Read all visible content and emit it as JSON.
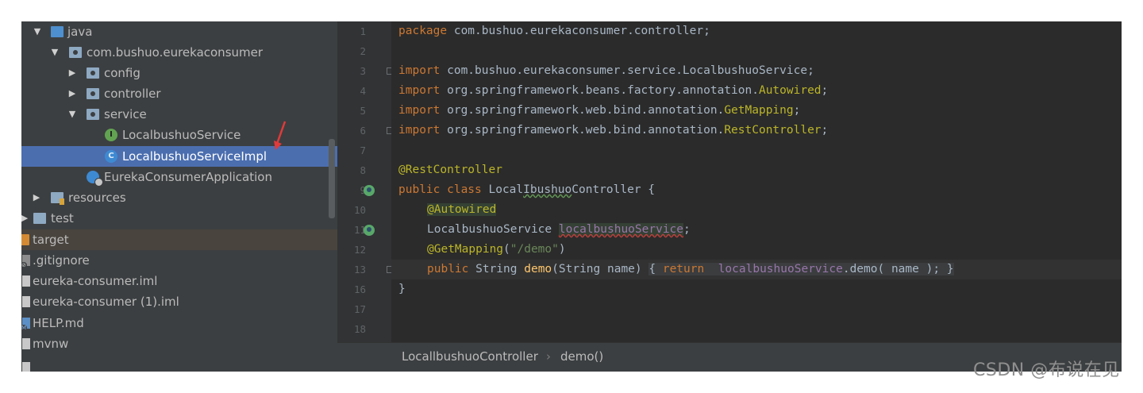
{
  "tree": {
    "items": [
      {
        "label": "java",
        "expanded": true
      },
      {
        "label": "com.bushuo.eurekaconsumer",
        "expanded": true
      },
      {
        "label": "config",
        "expanded": false
      },
      {
        "label": "controller",
        "expanded": false
      },
      {
        "label": "service",
        "expanded": true
      },
      {
        "label": "LocalbushuoService",
        "icon_letter": "I"
      },
      {
        "label": "LocalbushuoServiceImpl",
        "icon_letter": "C",
        "selected": true
      },
      {
        "label": "EurekaConsumerApplication"
      },
      {
        "label": "resources",
        "expanded": false
      },
      {
        "label": "test",
        "expanded": false
      },
      {
        "label": "target"
      },
      {
        "label": ".gitignore"
      },
      {
        "label": "eureka-consumer.iml"
      },
      {
        "label": "eureka-consumer (1).iml"
      },
      {
        "label": "HELP.md"
      },
      {
        "label": "mvnw"
      }
    ],
    "arrow_open": "▼",
    "arrow_closed": "▶"
  },
  "gutter": {
    "line_numbers": [
      "1",
      "2",
      "3",
      "4",
      "5",
      "6",
      "7",
      "8",
      "9",
      "10",
      "11",
      "12",
      "13",
      "16",
      "17",
      "18"
    ]
  },
  "code": {
    "l1": {
      "kw": "package",
      "text": " com.bushuo.eurekaconsumer.controller;"
    },
    "l3": {
      "kw": "import",
      "text": " com.bushuo.eurekaconsumer.service.LocalbushuoService;"
    },
    "l4": {
      "kw": "import",
      "pre": " org.springframework.beans.factory.annotation.",
      "ann": "Autowired",
      "post": ";"
    },
    "l5": {
      "kw": "import",
      "pre": " org.springframework.web.bind.annotation.",
      "ann": "GetMapping",
      "post": ";"
    },
    "l6": {
      "kw": "import",
      "pre": " org.springframework.web.bind.annotation.",
      "ann": "RestController",
      "post": ";"
    },
    "l8": {
      "ann": "@RestController"
    },
    "l9": {
      "kw": "public class",
      "pre": " Local",
      "squig": "Ibushuo",
      "post": "Controller {"
    },
    "l10": {
      "ann": "@Autowired"
    },
    "l11": {
      "type": "LocalbushuoService ",
      "field": "localbushuoService",
      "post": ";"
    },
    "l12": {
      "ann": "@GetMapping",
      "pre": "(",
      "str": "\"/demo\"",
      "post": ")"
    },
    "l13": {
      "kw": "public",
      "pre": " String ",
      "fn": "demo",
      "mid": "(String name) ",
      "fold_open": "{ ",
      "kw2": "return",
      "gap": "  ",
      "field": "localbushuoService",
      "rest": ".demo( name )",
      "fold_close": "; }"
    },
    "l16": {
      "text": "}"
    }
  },
  "breadcrumb": {
    "class_name": "LocallbushuoController",
    "separator": "›",
    "method": "demo()"
  },
  "watermark": "CSDN @布说在见",
  "colors": {
    "keyword": "#cc7832",
    "annotation": "#bbb529",
    "string": "#6a8759",
    "method": "#ffc66d",
    "field": "#9876aa",
    "selection": "#4b6eaf"
  }
}
